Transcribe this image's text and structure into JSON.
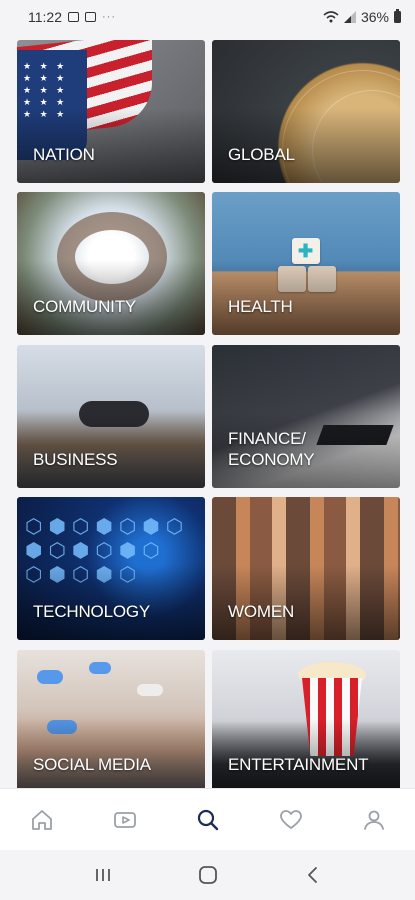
{
  "status_bar": {
    "time": "11:22",
    "battery": "36%",
    "dots": "···"
  },
  "categories": [
    {
      "label": "NATION"
    },
    {
      "label": "GLOBAL"
    },
    {
      "label": "COMMUNITY"
    },
    {
      "label": "HEALTH"
    },
    {
      "label": "BUSINESS"
    },
    {
      "label": "FINANCE/ ECONOMY"
    },
    {
      "label": "TECHNOLOGY"
    },
    {
      "label": "WOMEN"
    },
    {
      "label": "SOCIAL MEDIA"
    },
    {
      "label": "ENTERTAINMENT"
    }
  ],
  "bottom_nav": {
    "items": [
      {
        "icon": "home-icon"
      },
      {
        "icon": "video-play-icon"
      },
      {
        "icon": "search-icon",
        "active": true
      },
      {
        "icon": "heart-icon"
      },
      {
        "icon": "profile-icon"
      }
    ],
    "active_color": "#1f2a5a",
    "inactive_color": "#9aa0a8"
  },
  "android_nav": {
    "items": [
      {
        "icon": "recents-icon"
      },
      {
        "icon": "home-square-icon"
      },
      {
        "icon": "back-icon"
      }
    ]
  }
}
